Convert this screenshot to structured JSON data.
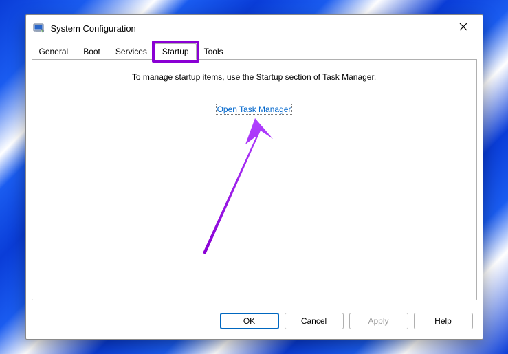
{
  "title": "System Configuration",
  "tabs": [
    "General",
    "Boot",
    "Services",
    "Startup",
    "Tools"
  ],
  "active_tab_index": 3,
  "pane": {
    "info": "To manage startup items, use the Startup section of Task Manager.",
    "link": "Open Task Manager"
  },
  "buttons": {
    "ok": "OK",
    "cancel": "Cancel",
    "apply": "Apply",
    "help": "Help"
  },
  "annotation": {
    "highlight_color": "#8a00d4"
  }
}
